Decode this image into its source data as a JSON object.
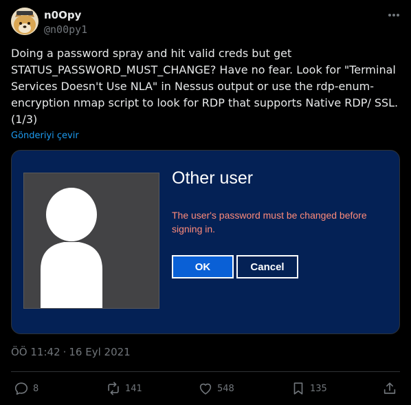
{
  "author": {
    "name": "n0Opy",
    "handle": "@n00py1"
  },
  "tweet": {
    "lines": [
      "Doing a password spray and hit valid creds but get",
      "STATUS_PASSWORD_MUST_CHANGE?  Have no fear.  Look for \"Terminal",
      "Services Doesn't Use NLA\" in Nessus output or use the rdp-enum-",
      "encryption nmap script to look for RDP that supports Native RDP/ SSL.",
      "(1/3)"
    ],
    "translate_label": "Gönderiyi çevir"
  },
  "media": {
    "dialog_title": "Other user",
    "message_lines": [
      "The user's password must be changed before",
      "signing in."
    ],
    "ok_label": "OK",
    "cancel_label": "Cancel",
    "background_color": "#042155",
    "message_color": "#ff8b7a",
    "ok_color": "#0a60d6"
  },
  "meta": {
    "time": "ÖÖ 11:42",
    "separator": "·",
    "date": "16 Eyl 2021"
  },
  "actions": {
    "replies": "8",
    "reposts": "141",
    "likes": "548",
    "bookmarks": "135"
  },
  "icons": [
    "avatar-doge",
    "more-icon",
    "reply-icon",
    "repost-icon",
    "like-icon",
    "bookmark-icon",
    "share-icon"
  ]
}
